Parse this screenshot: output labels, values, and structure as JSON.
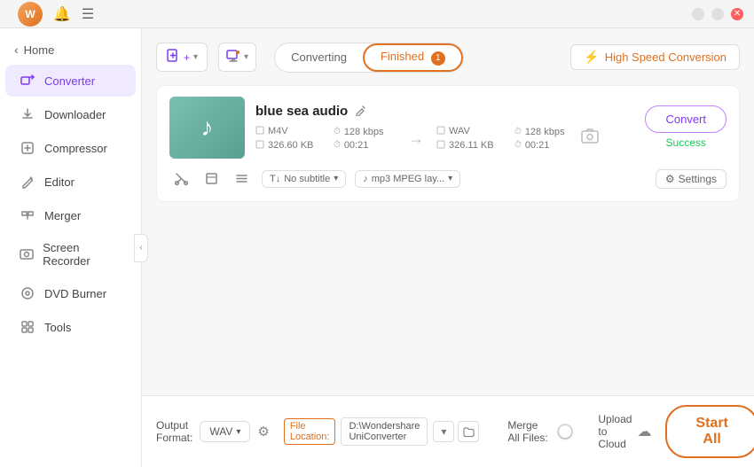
{
  "titlebar": {
    "user_icon": "W",
    "bell_icon": "🔔",
    "menu_icon": "☰",
    "minimize_icon": "−",
    "maximize_icon": "□",
    "close_icon": "✕"
  },
  "sidebar": {
    "back_label": "Home",
    "items": [
      {
        "id": "converter",
        "label": "Converter",
        "icon": "⇄",
        "active": true
      },
      {
        "id": "downloader",
        "label": "Downloader",
        "icon": "↓"
      },
      {
        "id": "compressor",
        "label": "Compressor",
        "icon": "⊡"
      },
      {
        "id": "editor",
        "label": "Editor",
        "icon": "✎"
      },
      {
        "id": "merger",
        "label": "Merger",
        "icon": "⊞"
      },
      {
        "id": "screen-recorder",
        "label": "Screen Recorder",
        "icon": "⊙"
      },
      {
        "id": "dvd-burner",
        "label": "DVD Burner",
        "icon": "◎"
      },
      {
        "id": "tools",
        "label": "Tools",
        "icon": "⊞"
      }
    ]
  },
  "toolbar": {
    "add_file_label": "Add File",
    "add_icon": "📄",
    "add_dropdown_icon": "▾",
    "screen_record_label": "",
    "screen_icon": "📷"
  },
  "tabs": {
    "converting_label": "Converting",
    "finished_label": "Finished",
    "finished_badge": "1"
  },
  "speed_conversion": {
    "label": "High Speed Conversion",
    "icon": "⚡"
  },
  "file_card": {
    "thumbnail_icon": "♪",
    "file_name": "blue sea audio",
    "edit_icon": "✎",
    "source": {
      "format": "M4V",
      "bitrate": "128 kbps",
      "size": "326.60 KB",
      "duration": "00:21",
      "format_icon": "□",
      "size_icon": "□",
      "bitrate_icon": "⏱",
      "duration_icon": "⏱"
    },
    "arrow": "→",
    "target": {
      "format": "WAV",
      "bitrate": "128 kbps",
      "size": "326.11 KB",
      "duration": "00:21",
      "format_icon": "□",
      "size_icon": "□",
      "bitrate_icon": "⏱",
      "duration_icon": "⏱"
    },
    "extra_icon": "🖼",
    "convert_btn_label": "Convert",
    "success_label": "Success",
    "cut_icon": "✂",
    "crop_icon": "⊡",
    "menu_icon": "≡",
    "subtitle_label": "No subtitle",
    "subtitle_icon": "T",
    "audio_label": "mp3 MPEG lay...",
    "audio_icon": "♪",
    "settings_label": "Settings",
    "settings_icon": "⚙"
  },
  "bottom_bar": {
    "output_format_label": "Output Format:",
    "format_value": "WAV",
    "format_dropdown_icon": "▾",
    "settings_icon": "⚙",
    "file_location_label": "File Location:",
    "location_path": "D:\\Wondershare UniConverter",
    "location_dropdown_icon": "▾",
    "location_folder_icon": "📁",
    "merge_files_label": "Merge All Files:",
    "upload_cloud_label": "Upload to Cloud",
    "cloud_icon": "☁",
    "start_all_label": "Start All"
  }
}
